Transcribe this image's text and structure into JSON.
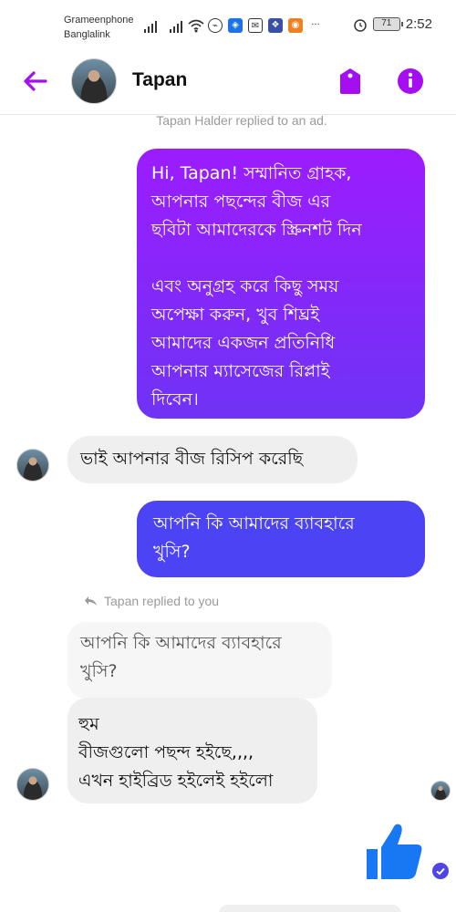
{
  "status_bar": {
    "carrier_1": "Grameenphone",
    "carrier_2": "Banglalink",
    "battery": "71",
    "time": "2:52",
    "more": "···"
  },
  "header": {
    "contact_name": "Tapan",
    "accent_color": "#a40ef0",
    "icons": [
      "back-arrow-icon",
      "tag-icon",
      "info-icon"
    ]
  },
  "conversation": {
    "ad_reply_notice": "Tapan Halder replied to an ad.",
    "outgoing_1": "Hi, Tapan! সম্মানিত গ্রাহক,\nআপনার পছন্দের বীজ এর\nছবিটা আমাদেরকে স্ক্রিনশট দিন\n\nএবং অনুগ্রহ করে কিছু সময়\nঅপেক্ষা করুন, খুব শিঘ্রই\nআমাদের একজন প্রতিনিধি\nআপনার ম্যাসেজের রিপ্লাই\nদিবেন।",
    "incoming_1": "ভাই আপনার বীজ রিসিপ করেছি",
    "outgoing_2": "আপনি কি আমাদের ব্যাবহারে\nখুসি?",
    "reply_label": "Tapan replied to you",
    "quoted_text": "আপনি কি আমাদের ব্যাবহারে\nখুসি?",
    "incoming_2": "হুম\nবীজগুলো পছন্দ হইছে,,,,\nএখন হাইব্রিড হইলেই হইলো",
    "like_icon": "thumbs-up-icon"
  },
  "colors": {
    "outgoing_gradient_top": "#9c1cff",
    "outgoing_gradient_bottom": "#6f33f5",
    "outgoing_2": "#4b43f4",
    "incoming": "#efefef",
    "like_blue": "#1877f2"
  }
}
